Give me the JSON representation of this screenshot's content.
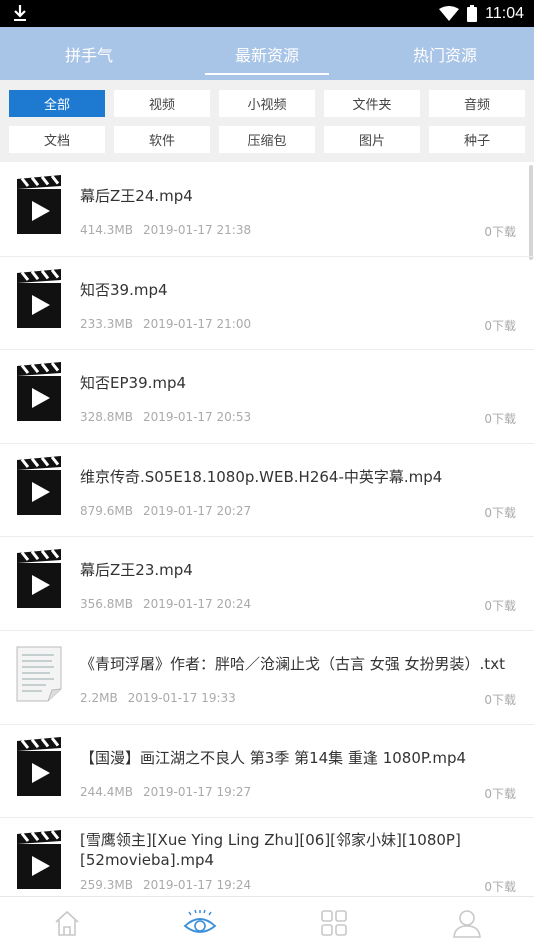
{
  "status": {
    "time": "11:04"
  },
  "tabs": [
    {
      "label": "拼手气"
    },
    {
      "label": "最新资源"
    },
    {
      "label": "热门资源"
    }
  ],
  "active_tab": 1,
  "filters": {
    "row1": [
      "全部",
      "视频",
      "小视频",
      "文件夹",
      "音频"
    ],
    "row2": [
      "文档",
      "软件",
      "压缩包",
      "图片",
      "种子"
    ],
    "active": "全部"
  },
  "colors": {
    "accent": "#1e7ad0",
    "tabbar": "#a8c4e6",
    "nav_active": "#3a8fd8",
    "nav_inactive": "#c8c8c8"
  },
  "items": [
    {
      "icon": "video-file-icon",
      "name": "幕后Z王24.mp4",
      "size": "414.3MB",
      "date": "2019-01-17 21:38",
      "downloads": "0下载"
    },
    {
      "icon": "video-file-icon",
      "name": "知否39.mp4",
      "size": "233.3MB",
      "date": "2019-01-17 21:00",
      "downloads": "0下载"
    },
    {
      "icon": "video-file-icon",
      "name": "知否EP39.mp4",
      "size": "328.8MB",
      "date": "2019-01-17 20:53",
      "downloads": "0下载"
    },
    {
      "icon": "video-file-icon",
      "name": "维京传奇.S05E18.1080p.WEB.H264-中英字幕.mp4",
      "size": "879.6MB",
      "date": "2019-01-17 20:27",
      "downloads": "0下载"
    },
    {
      "icon": "video-file-icon",
      "name": "幕后Z王23.mp4",
      "size": "356.8MB",
      "date": "2019-01-17 20:24",
      "downloads": "0下载"
    },
    {
      "icon": "text-file-icon",
      "name": "《青珂浮屠》作者：胖哈／沧澜止戈（古言 女强 女扮男装）.txt",
      "size": "2.2MB",
      "date": "2019-01-17 19:33",
      "downloads": "0下载"
    },
    {
      "icon": "video-file-icon",
      "name": "【国漫】画江湖之不良人 第3季 第14集 重逢 1080P.mp4",
      "size": "244.4MB",
      "date": "2019-01-17 19:27",
      "downloads": "0下载"
    },
    {
      "icon": "video-file-icon",
      "name": "[雪鹰领主][Xue Ying Ling Zhu][06][邻家小妹][1080P][52movieba].mp4",
      "size": "259.3MB",
      "date": "2019-01-17 19:24",
      "downloads": "0下载"
    }
  ],
  "bottom_nav": [
    {
      "icon": "home-icon"
    },
    {
      "icon": "eye-icon"
    },
    {
      "icon": "grid-icon"
    },
    {
      "icon": "user-icon"
    }
  ],
  "bottom_nav_active": 1
}
